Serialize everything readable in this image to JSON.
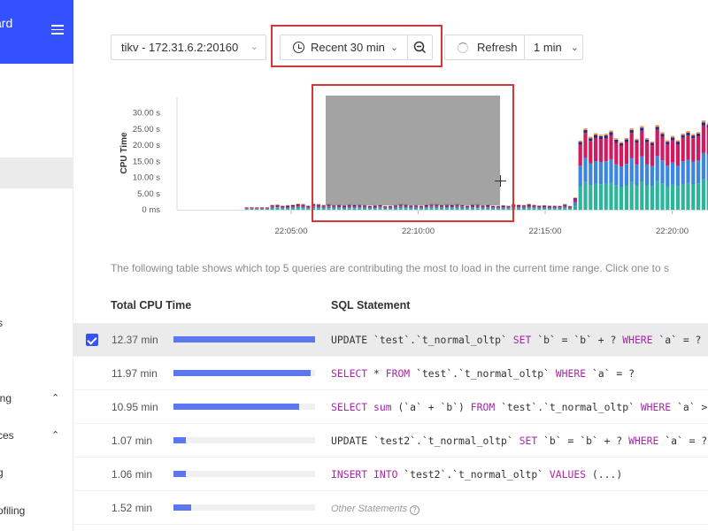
{
  "sidebar": {
    "brand_text": "ard",
    "items": [
      {
        "label": "s",
        "top": 0
      },
      {
        "label": "ing",
        "chevron": "⌃"
      },
      {
        "label": "ces",
        "chevron": "⌃"
      },
      {
        "label": "g"
      },
      {
        "label": "ofiling"
      }
    ]
  },
  "toolbar": {
    "instance": "tikv - 172.31.6.2:20160",
    "time_range": "Recent 30 min",
    "refresh": "Refresh",
    "interval": "1 min"
  },
  "chart_data": {
    "type": "bar",
    "stacked": true,
    "ylabel": "CPU Time",
    "y_ticks": [
      "0 ms",
      "5.00 s",
      "10.00 s",
      "15.00 s",
      "20.00 s",
      "25.00 s",
      "30.00 s"
    ],
    "ylim": [
      0,
      33
    ],
    "x_ticks": [
      "22:05:00",
      "22:10:00",
      "22:15:00",
      "22:20:00"
    ],
    "colors": {
      "teal": "#2bb59a",
      "blue": "#3a86e0",
      "crimson": "#d11a5f",
      "navy": "#2a2a80",
      "orange": "#f0944d"
    },
    "selection": {
      "from": "22:06:30",
      "to": "22:13:00"
    },
    "series_order": [
      "teal",
      "blue",
      "crimson",
      "navy",
      "orange"
    ],
    "phases": [
      {
        "name": "idle",
        "minutes": [
          0,
          2
        ],
        "values": [
          0,
          0,
          0,
          0,
          0
        ]
      },
      {
        "name": "low",
        "minutes": [
          2,
          14
        ],
        "values": [
          0.4,
          0.3,
          0.3,
          0.3,
          0.2
        ]
      },
      {
        "name": "ramp",
        "minutes": [
          14,
          14.3
        ],
        "values": [
          1.5,
          1.2,
          1.0,
          0.5,
          0.3
        ]
      },
      {
        "name": "high",
        "minutes": [
          14.3,
          20
        ],
        "values": [
          8.3,
          7.3,
          7.5,
          0.9,
          0.5
        ]
      }
    ]
  },
  "description": "The following table shows which top 5 queries are contributing the most to load in the current time range. Click one to s",
  "table": {
    "col_cpu": "Total CPU Time",
    "col_sql": "SQL Statement",
    "rows": [
      {
        "cpu": "12.37 min",
        "pct": 1.0,
        "sql": "UPDATE `test`.`t_normal_oltp` SET `b` = `b` + ? WHERE `a` = ?",
        "selected": true
      },
      {
        "cpu": "11.97 min",
        "pct": 0.968,
        "sql": "SELECT * FROM `test`.`t_normal_oltp` WHERE `a` = ?"
      },
      {
        "cpu": "10.95 min",
        "pct": 0.885,
        "sql": "SELECT sum (`a` + `b`) FROM `test`.`t_normal_oltp` WHERE `a` > ?"
      },
      {
        "cpu": "1.07 min",
        "pct": 0.087,
        "sql": "UPDATE `test2`.`t_normal_oltp` SET `b` = `b` + ? WHERE `a` = ?"
      },
      {
        "cpu": "1.06 min",
        "pct": 0.086,
        "sql": "INSERT INTO `test2`.`t_normal_oltp` VALUES (...)"
      },
      {
        "cpu": "1.52 min",
        "pct": 0.123,
        "sql": "Other Statements",
        "other": true
      }
    ]
  }
}
